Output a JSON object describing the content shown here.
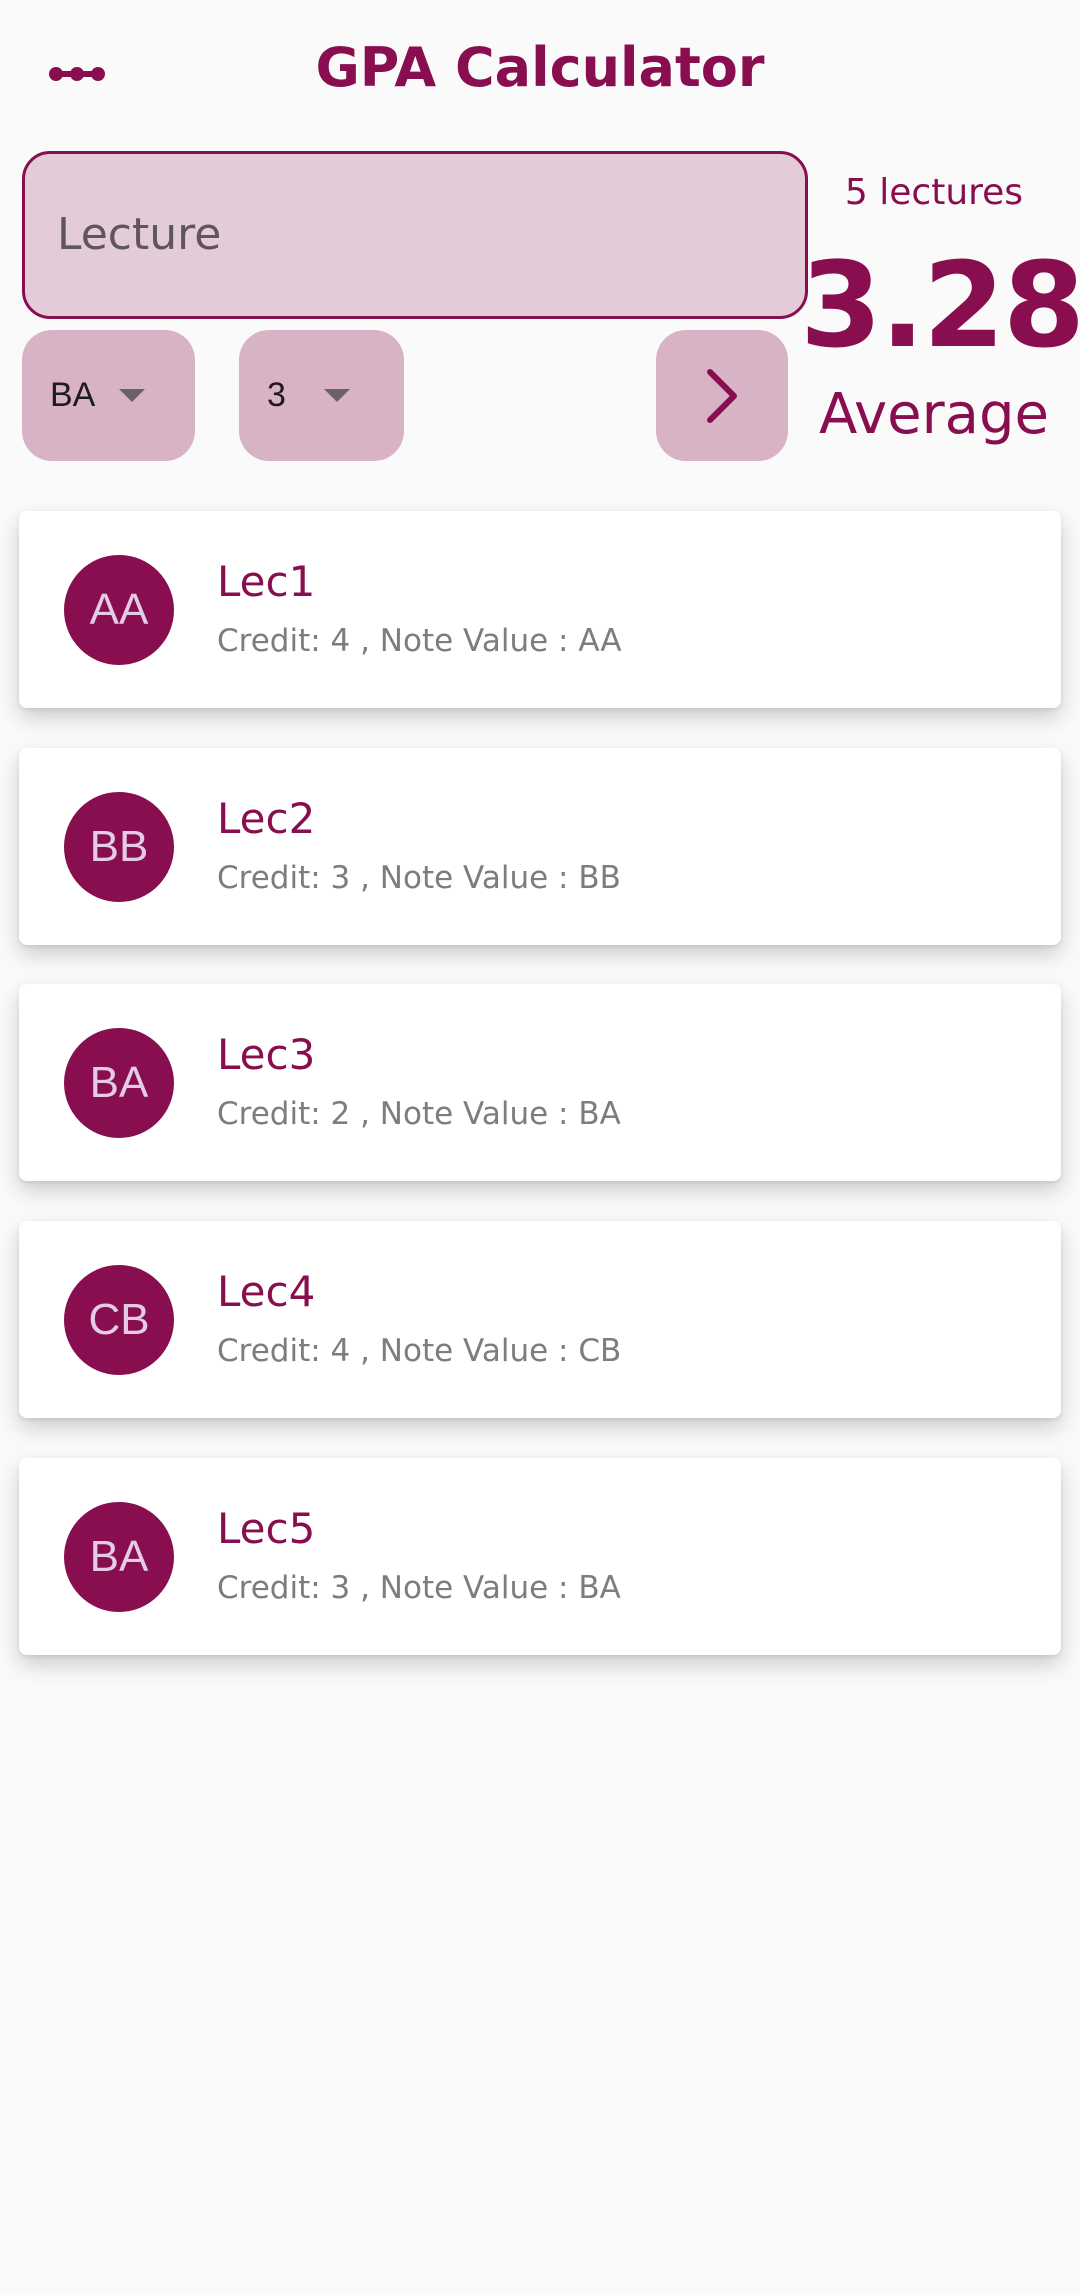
{
  "header": {
    "title": "GPA Calculator",
    "menu_icon": "more-horiz-icon"
  },
  "form": {
    "lecture_placeholder": "Lecture",
    "note_selected": "BA",
    "credit_selected": "3",
    "add_icon": "chevron-right-icon"
  },
  "summary": {
    "count_text": "5 lectures",
    "average": "3.28",
    "average_label": "Average"
  },
  "lectures": [
    {
      "badge": "AA",
      "name": "Lec1",
      "detail": "Credit: 4 , Note Value : AA"
    },
    {
      "badge": "BB",
      "name": "Lec2",
      "detail": "Credit: 3 , Note Value : BB"
    },
    {
      "badge": "BA",
      "name": "Lec3",
      "detail": "Credit: 2 , Note Value : BA"
    },
    {
      "badge": "CB",
      "name": "Lec4",
      "detail": "Credit: 4 , Note Value : CB"
    },
    {
      "badge": "BA",
      "name": "Lec5",
      "detail": "Credit: 3 , Note Value : BA"
    }
  ],
  "colors": {
    "primary": "#880e4f",
    "input_fill": "#e4cbd8",
    "control_fill": "#d8b3c6",
    "background": "#fafafa"
  }
}
